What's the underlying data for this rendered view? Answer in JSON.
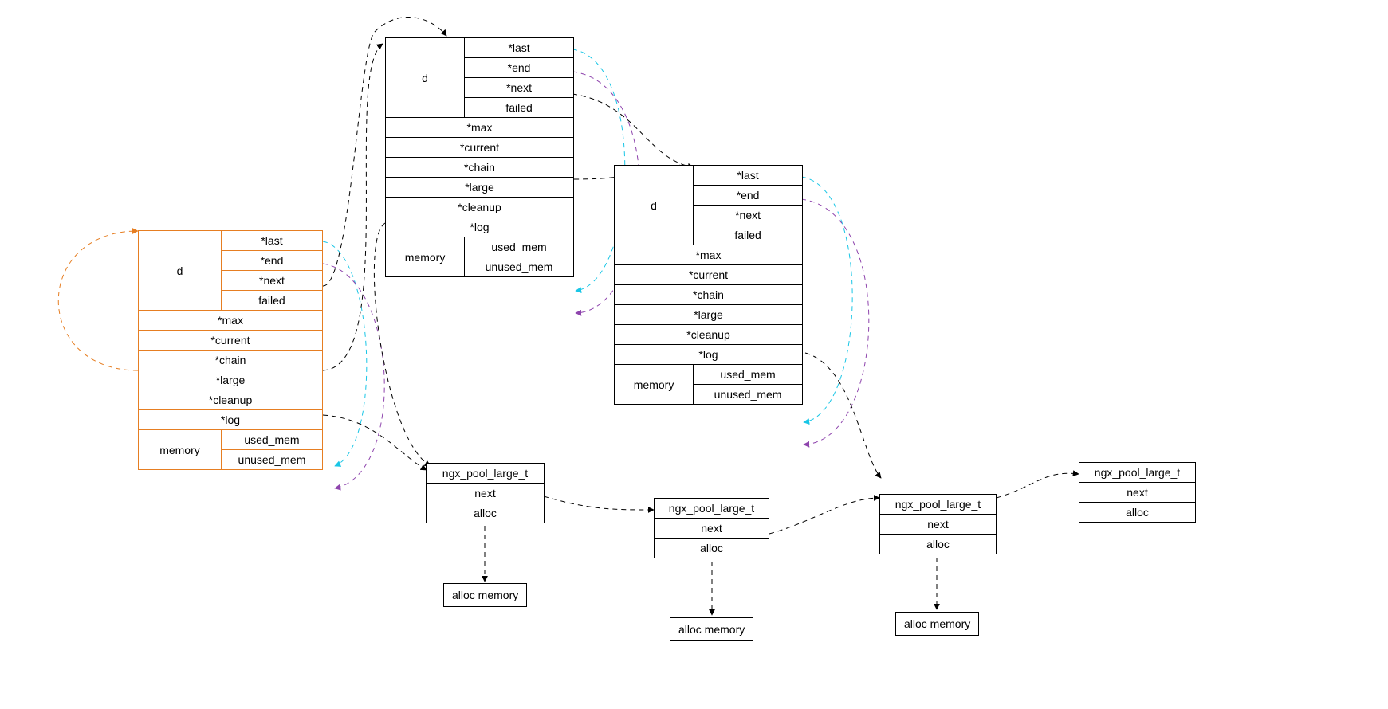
{
  "colors": {
    "orange": "#e67e22",
    "cyan": "#19c6e6",
    "purple": "#8e44ad",
    "black": "#000000"
  },
  "pool1": {
    "d_label": "d",
    "d": {
      "last": "*last",
      "end": "*end",
      "next": "*next",
      "failed": "failed"
    },
    "max": "*max",
    "current": "*current",
    "chain": "*chain",
    "large": "*large",
    "cleanup": "*cleanup",
    "log": "*log",
    "memory_label": "memory",
    "memory": {
      "used": "used_mem",
      "unused": "unused_mem"
    }
  },
  "pool2": {
    "d_label": "d",
    "d": {
      "last": "*last",
      "end": "*end",
      "next": "*next",
      "failed": "failed"
    },
    "max": "*max",
    "current": "*current",
    "chain": "*chain",
    "large": "*large",
    "cleanup": "*cleanup",
    "log": "*log",
    "memory_label": "memory",
    "memory": {
      "used": "used_mem",
      "unused": "unused_mem"
    }
  },
  "pool3": {
    "d_label": "d",
    "d": {
      "last": "*last",
      "end": "*end",
      "next": "*next",
      "failed": "failed"
    },
    "max": "*max",
    "current": "*current",
    "chain": "*chain",
    "large": "*large",
    "cleanup": "*cleanup",
    "log": "*log",
    "memory_label": "memory",
    "memory": {
      "used": "used_mem",
      "unused": "unused_mem"
    }
  },
  "large1": {
    "title": "ngx_pool_large_t",
    "next": "next",
    "alloc": "alloc",
    "alloc_mem": "alloc memory"
  },
  "large2": {
    "title": "ngx_pool_large_t",
    "next": "next",
    "alloc": "alloc",
    "alloc_mem": "alloc memory"
  },
  "large3": {
    "title": "ngx_pool_large_t",
    "next": "next",
    "alloc": "alloc",
    "alloc_mem": "alloc memory"
  },
  "large4": {
    "title": "ngx_pool_large_t",
    "next": "next",
    "alloc": "alloc"
  },
  "edges": [
    {
      "from": "pool1.current",
      "to": "pool1",
      "style": "orange",
      "kind": "self-loop"
    },
    {
      "from": "pool1.d.last",
      "to": "pool1.memory.used",
      "style": "cyan"
    },
    {
      "from": "pool1.d.end",
      "to": "pool1.memory.unused",
      "style": "purple"
    },
    {
      "from": "pool1.d.next",
      "to": "pool2",
      "style": "black"
    },
    {
      "from": "pool1.current",
      "to": "pool2",
      "style": "black"
    },
    {
      "from": "pool1.large",
      "to": "large1",
      "style": "black"
    },
    {
      "from": "pool2.d.last",
      "to": "pool2.memory.used",
      "style": "cyan"
    },
    {
      "from": "pool2.d.end",
      "to": "pool2.memory.unused",
      "style": "purple"
    },
    {
      "from": "pool2.d.next",
      "to": "pool3",
      "style": "black"
    },
    {
      "from": "pool2.current",
      "to": "pool3",
      "style": "black"
    },
    {
      "from": "pool2.large",
      "to": "large1",
      "style": "black"
    },
    {
      "from": "pool3.d.last",
      "to": "pool3.memory.used",
      "style": "cyan"
    },
    {
      "from": "pool3.d.end",
      "to": "pool3.memory.unused",
      "style": "purple"
    },
    {
      "from": "pool3.large",
      "to": "large3",
      "style": "black"
    },
    {
      "from": "large1.next",
      "to": "large2",
      "style": "black"
    },
    {
      "from": "large2.next",
      "to": "large3",
      "style": "black"
    },
    {
      "from": "large3.next",
      "to": "large4",
      "style": "black"
    },
    {
      "from": "large1.alloc",
      "to": "large1.alloc_mem",
      "style": "black"
    },
    {
      "from": "large2.alloc",
      "to": "large2.alloc_mem",
      "style": "black"
    },
    {
      "from": "large3.alloc",
      "to": "large3.alloc_mem",
      "style": "black"
    }
  ]
}
